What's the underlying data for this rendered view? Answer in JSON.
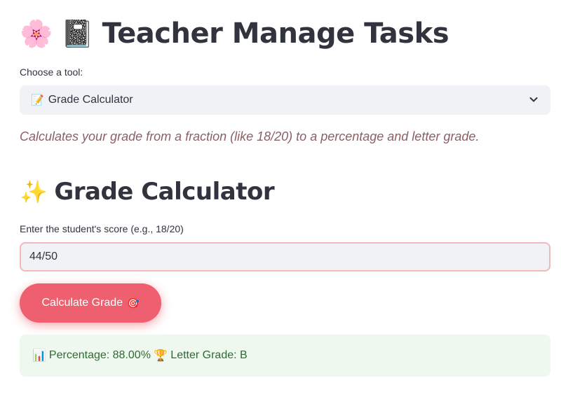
{
  "header": {
    "icon_1": "🌸",
    "icon_2": "📓",
    "title": "Teacher Manage Tasks"
  },
  "tool_select": {
    "label": "Choose a tool:",
    "selected_icon": "📝",
    "selected_value": "Grade Calculator"
  },
  "description": "Calculates your grade from a fraction (like 18/20) to a percentage and letter grade.",
  "section": {
    "icon": "✨",
    "title": "Grade Calculator"
  },
  "score_input": {
    "label": "Enter the student's score (e.g., 18/20)",
    "value": "44/50"
  },
  "calculate_button": {
    "label": "Calculate Grade",
    "icon": "🎯"
  },
  "result": {
    "percentage_icon": "📊",
    "percentage_text": "Percentage: 88.00%",
    "grade_icon": "🏆",
    "grade_text": "Letter Grade: B"
  },
  "colors": {
    "accent": "#ee5f6f",
    "success_bg": "#eff8ef",
    "success_text": "#2e6b33",
    "description_text": "#8b5f66",
    "input_bg": "#f0f2f6"
  }
}
